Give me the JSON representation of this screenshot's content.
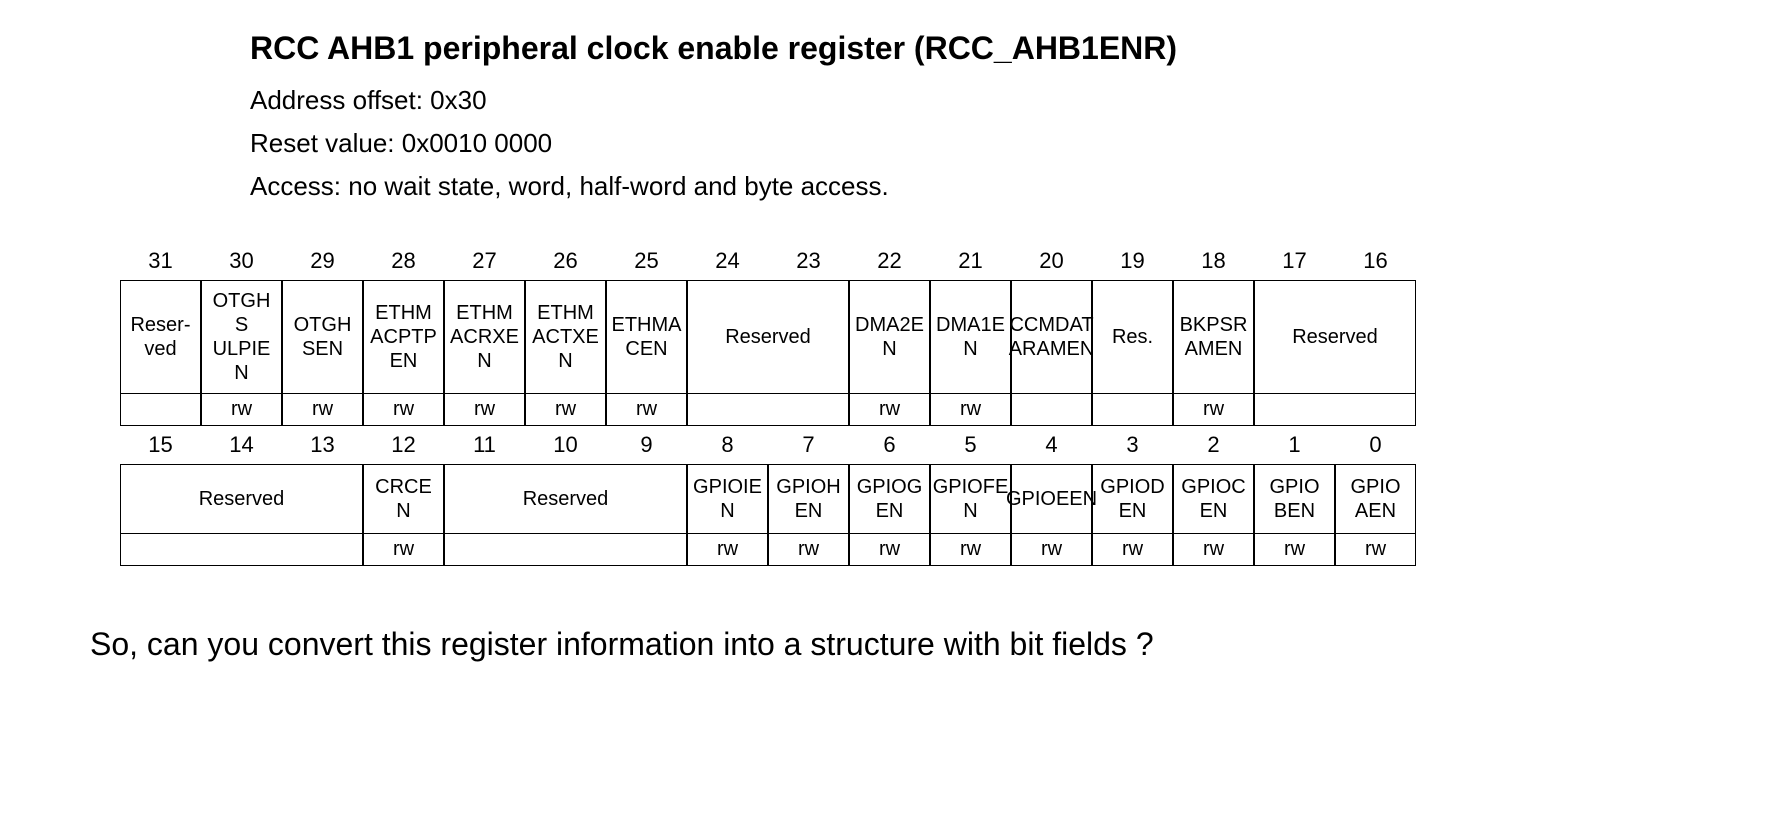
{
  "title": "RCC AHB1 peripheral clock enable register (RCC_AHB1ENR)",
  "address_offset": "Address offset: 0x30",
  "reset_value": "Reset value: 0x0010 0000",
  "access": "Access: no wait state, word, half-word and byte access.",
  "bits_high": [
    "31",
    "30",
    "29",
    "28",
    "27",
    "26",
    "25",
    "24",
    "23",
    "22",
    "21",
    "20",
    "19",
    "18",
    "17",
    "16"
  ],
  "bits_low": [
    "15",
    "14",
    "13",
    "12",
    "11",
    "10",
    "9",
    "8",
    "7",
    "6",
    "5",
    "4",
    "3",
    "2",
    "1",
    "0"
  ],
  "row_high": {
    "c31": "Reser-\nved",
    "c30": "OTGH\nS\nULPIE\nN",
    "c29": "OTGH\nSEN",
    "c28": "ETHM\nACPTP\nEN",
    "c27": "ETHM\nACRXE\nN",
    "c26": "ETHM\nACTXE\nN",
    "c25": "ETHMA\nCEN",
    "c24_23": "Reserved",
    "c22": "DMA2E\nN",
    "c21": "DMA1E\nN",
    "c20": "CCMDAT\nARAMEN",
    "c19": "Res.",
    "c18": "BKPSR\nAMEN",
    "c17_16": "Reserved"
  },
  "acc_high": {
    "a30": "rw",
    "a29": "rw",
    "a28": "rw",
    "a27": "rw",
    "a26": "rw",
    "a25": "rw",
    "a22": "rw",
    "a21": "rw",
    "a18": "rw"
  },
  "row_low": {
    "c15_13": "Reserved",
    "c12": "CRCE\nN",
    "c11_9": "Reserved",
    "c8": "GPIOIE\nN",
    "c7": "GPIOH\nEN",
    "c6": "GPIOG\nEN",
    "c5": "GPIOFE\nN",
    "c4": "GPIOEEN",
    "c3": "GPIOD\nEN",
    "c2": "GPIOC\nEN",
    "c1": "GPIO\nBEN",
    "c0": "GPIO\nAEN"
  },
  "acc_low": {
    "a12": "rw",
    "a8": "rw",
    "a7": "rw",
    "a6": "rw",
    "a5": "rw",
    "a4": "rw",
    "a3": "rw",
    "a2": "rw",
    "a1": "rw",
    "a0": "rw"
  },
  "question": "So, can you convert this register information into a structure with bit fields ?"
}
